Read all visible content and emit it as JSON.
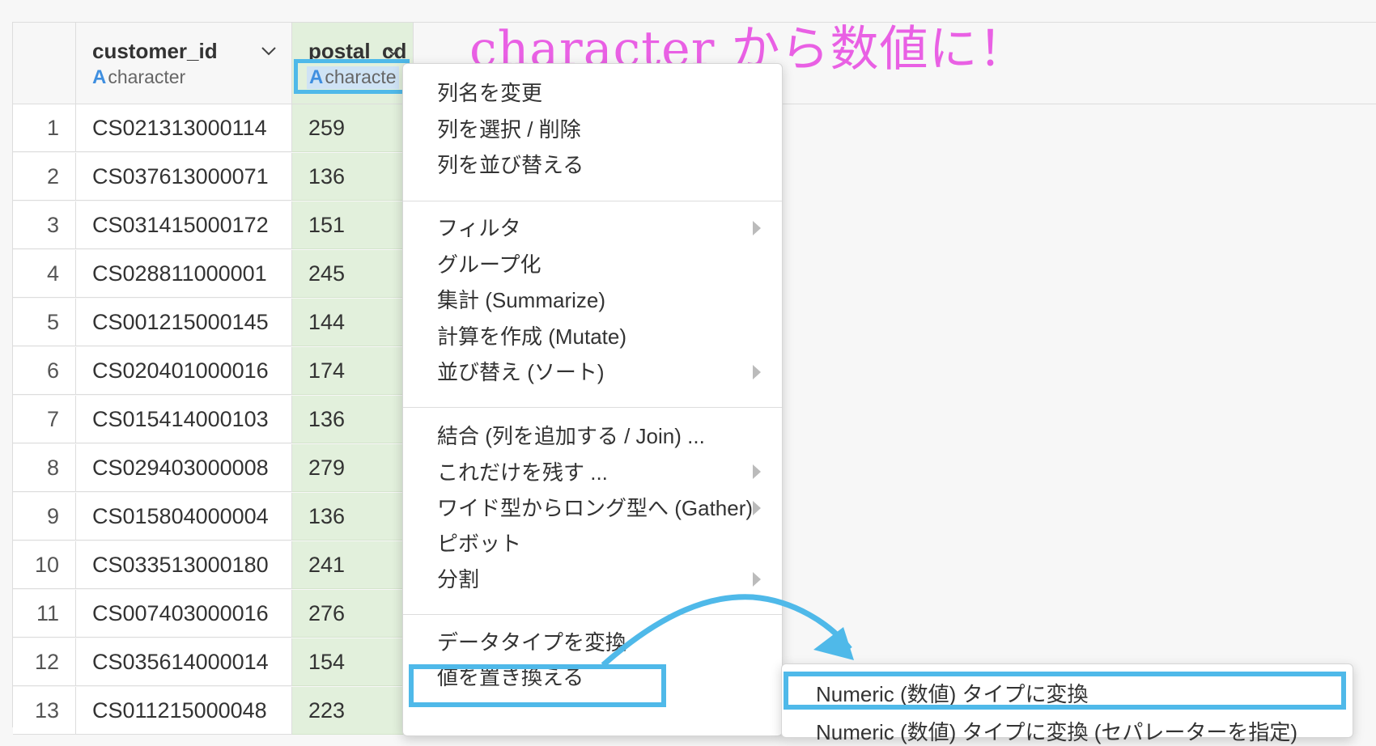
{
  "annotation_text": "character から数値に！",
  "columns": [
    {
      "name": "customer_id",
      "type": "character"
    },
    {
      "name": "postal_cd",
      "type": "characte"
    }
  ],
  "type_glyph": "A",
  "rows": [
    {
      "index": "1",
      "customer_id": "CS021313000114",
      "postal_cd": "259"
    },
    {
      "index": "2",
      "customer_id": "CS037613000071",
      "postal_cd": "136"
    },
    {
      "index": "3",
      "customer_id": "CS031415000172",
      "postal_cd": "151"
    },
    {
      "index": "4",
      "customer_id": "CS028811000001",
      "postal_cd": "245"
    },
    {
      "index": "5",
      "customer_id": "CS001215000145",
      "postal_cd": "144"
    },
    {
      "index": "6",
      "customer_id": "CS020401000016",
      "postal_cd": "174"
    },
    {
      "index": "7",
      "customer_id": "CS015414000103",
      "postal_cd": "136"
    },
    {
      "index": "8",
      "customer_id": "CS029403000008",
      "postal_cd": "279"
    },
    {
      "index": "9",
      "customer_id": "CS015804000004",
      "postal_cd": "136"
    },
    {
      "index": "10",
      "customer_id": "CS033513000180",
      "postal_cd": "241"
    },
    {
      "index": "11",
      "customer_id": "CS007403000016",
      "postal_cd": "276"
    },
    {
      "index": "12",
      "customer_id": "CS035614000014",
      "postal_cd": "154"
    },
    {
      "index": "13",
      "customer_id": "CS011215000048",
      "postal_cd": "223"
    }
  ],
  "menu": {
    "items": [
      {
        "label": "列名を変更"
      },
      {
        "label": "列を選択 / 削除"
      },
      {
        "label": "列を並び替える"
      },
      {
        "label": "フィルタ"
      },
      {
        "label": "グループ化"
      },
      {
        "label": "集計 (Summarize)"
      },
      {
        "label": "計算を作成 (Mutate)"
      },
      {
        "label": "並び替え (ソート)"
      },
      {
        "label": "結合 (列を追加する / Join) ..."
      },
      {
        "label": "これだけを残す ..."
      },
      {
        "label": "ワイド型からロング型へ (Gather)"
      },
      {
        "label": "ピボット"
      },
      {
        "label": "分割"
      },
      {
        "label": "データタイプを変換"
      },
      {
        "label": "値を置き換える"
      }
    ]
  },
  "submenu": {
    "items": [
      {
        "label": "Numeric (数値) タイプに変換"
      },
      {
        "label": "Numeric (数値) タイプに変換 (セパレーターを指定)"
      }
    ]
  },
  "colors": {
    "highlight": "#4fb9e9",
    "annotation": "#e960e4",
    "selected_column": "#e2f0dc"
  }
}
